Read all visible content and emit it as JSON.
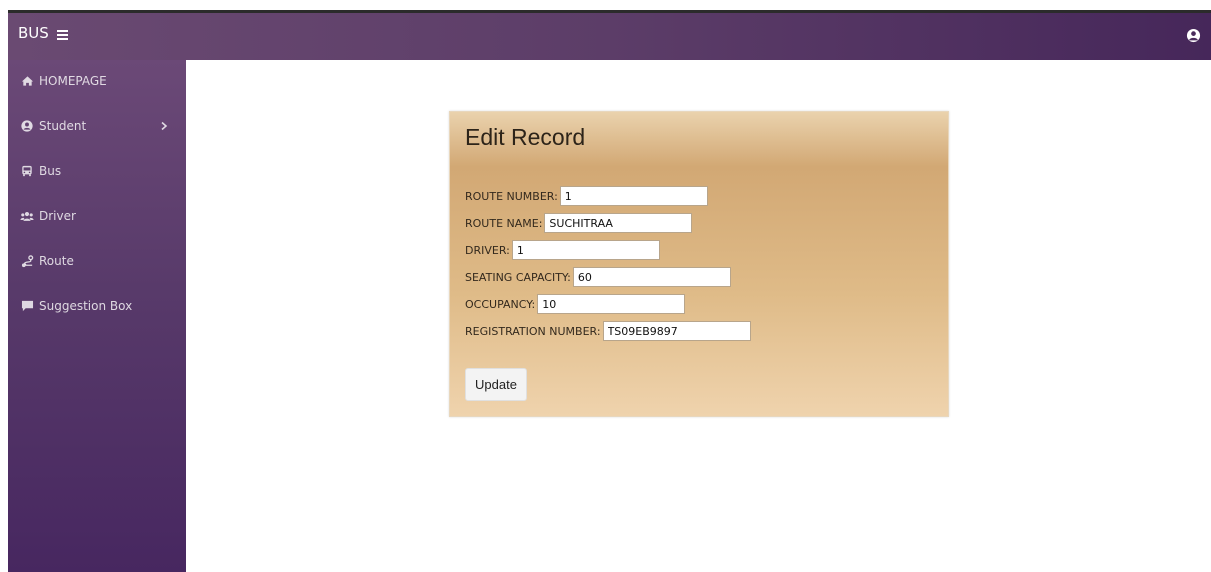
{
  "topbar": {
    "brand": "BUS",
    "icons": {
      "menu": "hamburger-icon",
      "user": "user-circle-icon"
    }
  },
  "sidebar": {
    "items": [
      {
        "label": "HOMEPAGE",
        "icon": "home-icon"
      },
      {
        "label": "Student",
        "icon": "user-circle-icon",
        "has_submenu": true
      },
      {
        "label": "Bus",
        "icon": "bus-icon"
      },
      {
        "label": "Driver",
        "icon": "users-icon"
      },
      {
        "label": "Route",
        "icon": "route-icon"
      },
      {
        "label": "Suggestion Box",
        "icon": "comment-icon"
      }
    ]
  },
  "form": {
    "title": "Edit Record",
    "fields": [
      {
        "label": "ROUTE NUMBER:",
        "value": "1"
      },
      {
        "label": "ROUTE NAME:",
        "value": "SUCHITRAA"
      },
      {
        "label": "DRIVER:",
        "value": "1"
      },
      {
        "label": "SEATING CAPACITY:",
        "value": "60"
      },
      {
        "label": "OCCUPANCY:",
        "value": "10"
      },
      {
        "label": "REGISTRATION NUMBER:",
        "value": "TS09EB9897"
      }
    ],
    "submit_label": "Update"
  },
  "colors": {
    "topbar": "#5c3d68",
    "sidebar_top": "#6b4977",
    "sidebar_bottom": "#472760",
    "card": "#d2a874"
  }
}
